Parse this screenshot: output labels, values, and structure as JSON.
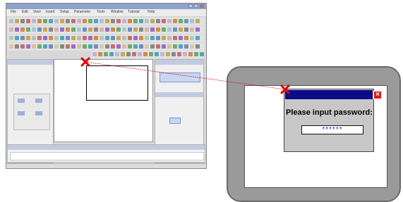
{
  "software": {
    "title": "",
    "menu": [
      "File",
      "Edit",
      "View",
      "Insert",
      "Setup",
      "Parameter",
      "Tools",
      "Window",
      "Tutorial",
      "Help"
    ],
    "left_panel_title": "",
    "left_items": [
      "",
      "",
      "",
      "",
      "",
      "",
      "",
      ""
    ],
    "right_panel_title": "",
    "right_items": [
      "",
      "",
      "",
      "",
      "",
      "",
      ""
    ],
    "output_title": "",
    "status": [
      "",
      ""
    ]
  },
  "device": {
    "dialog_title": "",
    "close_label": "×",
    "prompt": "Please input password:",
    "password_value": "******"
  },
  "colors": {
    "dialog_titlebar": "#0b0b88",
    "close_button": "#e01818",
    "marker": "#e00000",
    "password_text": "#2a2ae0",
    "device_bezel": "#9a9a9a"
  },
  "icons": {
    "marker_software": "red-x-marker-icon",
    "marker_device": "red-x-marker-icon",
    "close": "close-icon"
  }
}
